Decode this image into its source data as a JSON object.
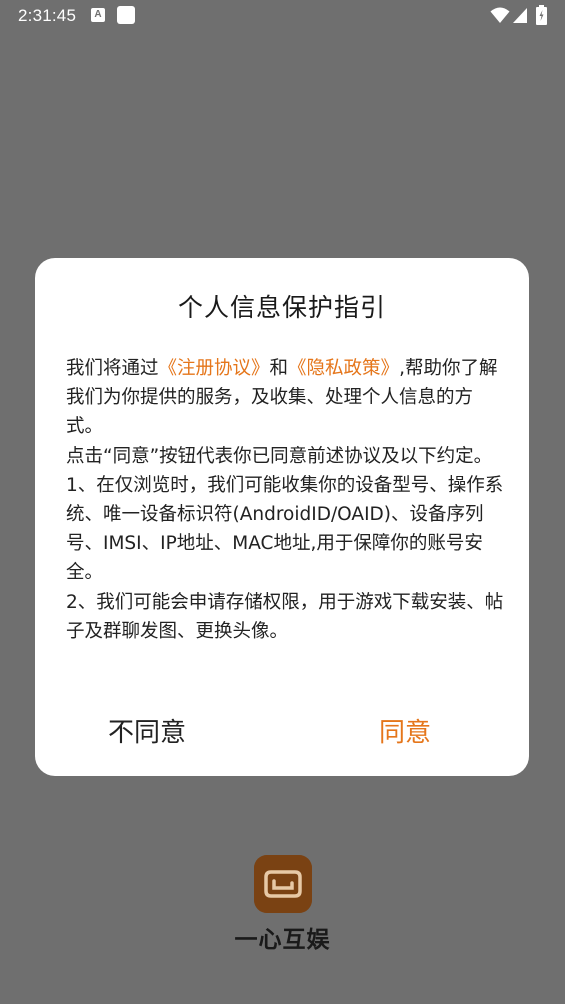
{
  "status_bar": {
    "time": "2:31:45",
    "notification_icon_letter": "A"
  },
  "dialog": {
    "title": "个人信息保护指引",
    "body": {
      "p1_prefix": "我们将通过",
      "link_register": "《注册协议》",
      "p1_and": "和",
      "link_privacy": "《隐私政策》",
      "p1_suffix": ",帮助你了解我们为你提供的服务，及收集、处理个人信息的方式。",
      "p2": "点击“同意”按钮代表你已同意前述协议及以下约定。",
      "p3": "1、在仅浏览时，我们可能收集你的设备型号、操作系统、唯一设备标识符(AndroidID/OAID)、设备序列号、IMSI、IP地址、MAC地址,用于保障你的账号安全。",
      "p4": "2、我们可能会申请存储权限，用于游戏下载安装、帖子及群聊发图、更换头像。"
    },
    "buttons": {
      "disagree": "不同意",
      "agree": "同意"
    }
  },
  "app": {
    "name": "一心互娱"
  },
  "colors": {
    "accent": "#e5761b",
    "logo_bg": "#7a4213",
    "backdrop": "#6f6f6f"
  }
}
